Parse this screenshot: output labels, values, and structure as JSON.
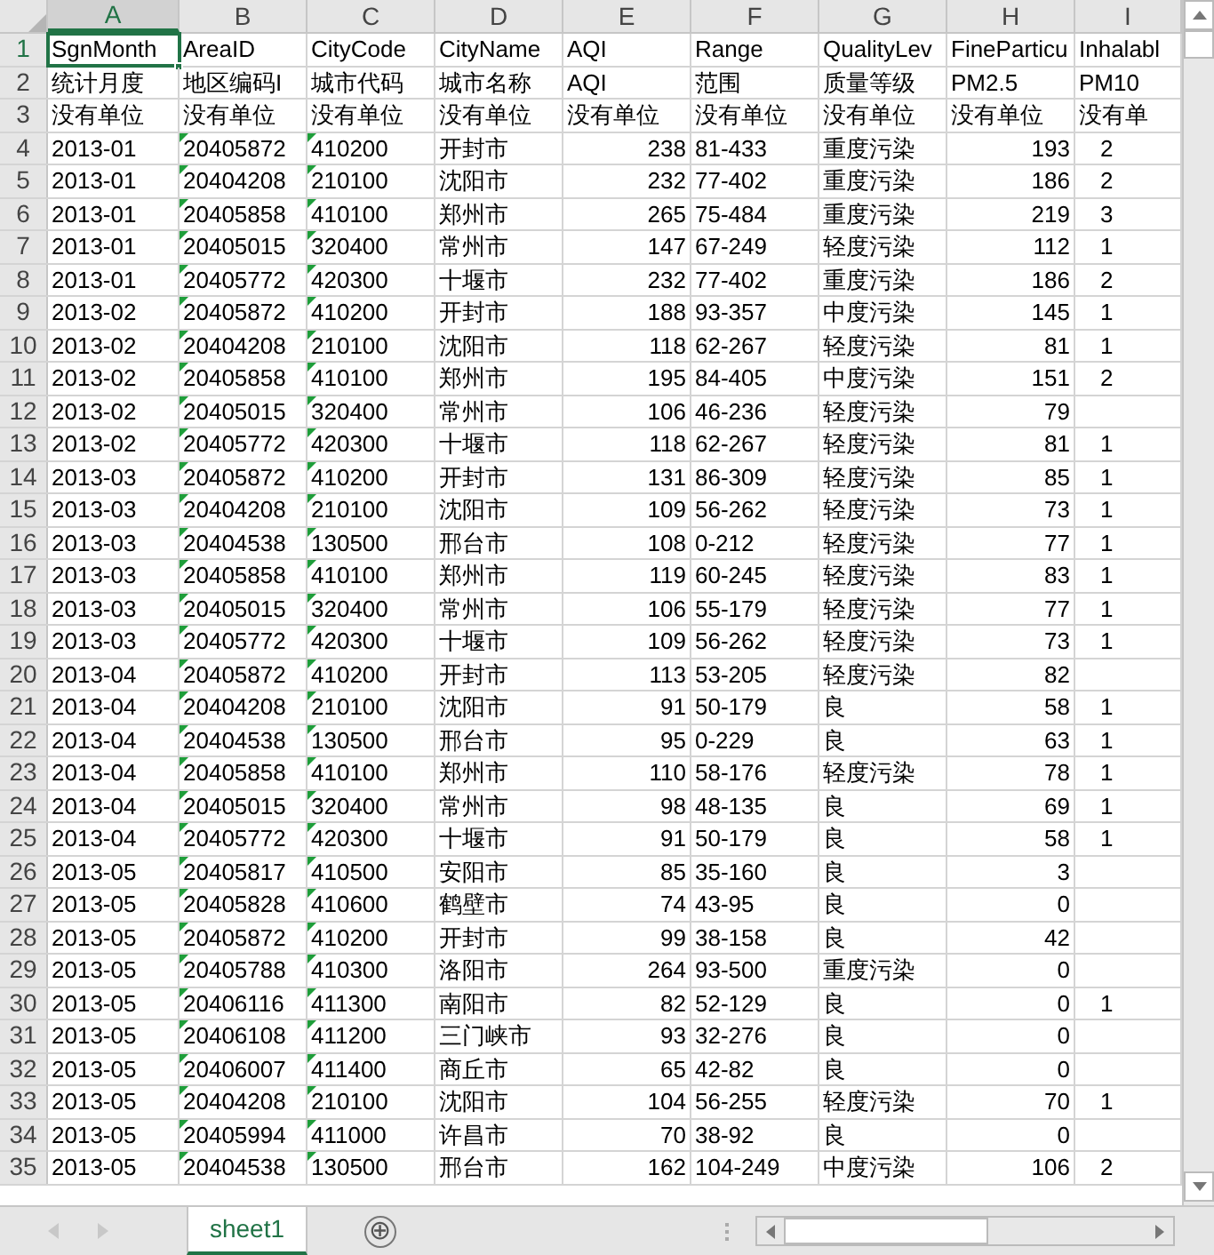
{
  "sheet": {
    "columns": [
      {
        "label": "A",
        "selected": true,
        "kind": "text"
      },
      {
        "label": "B",
        "selected": false,
        "kind": "flagged"
      },
      {
        "label": "C",
        "selected": false,
        "kind": "flagged"
      },
      {
        "label": "D",
        "selected": false,
        "kind": "text"
      },
      {
        "label": "E",
        "selected": false,
        "kind": "number"
      },
      {
        "label": "F",
        "selected": false,
        "kind": "text"
      },
      {
        "label": "G",
        "selected": false,
        "kind": "text"
      },
      {
        "label": "H",
        "selected": false,
        "kind": "number"
      },
      {
        "label": "I",
        "selected": false,
        "kind": "cut"
      }
    ],
    "rows": [
      {
        "number": "1",
        "selected": true,
        "kind": "header",
        "cells": [
          "SgnMonth",
          "AreaID",
          "CityCode",
          "CityName",
          "AQI",
          "Range",
          "QualityLev",
          "FineParticu",
          "Inhalabl"
        ]
      },
      {
        "number": "2",
        "selected": false,
        "kind": "header",
        "cells": [
          "统计月度",
          "地区编码I",
          "城市代码",
          "城市名称",
          "AQI",
          "范围",
          "质量等级",
          "PM2.5",
          "PM10"
        ]
      },
      {
        "number": "3",
        "selected": false,
        "kind": "header",
        "cells": [
          "没有单位",
          "没有单位",
          "没有单位",
          "没有单位",
          "没有单位",
          "没有单位",
          "没有单位",
          "没有单位",
          "没有单"
        ]
      },
      {
        "number": "4",
        "selected": false,
        "kind": "data",
        "cells": [
          "2013-01",
          "20405872",
          "410200",
          "开封市",
          "238",
          "81-433",
          "重度污染",
          "193",
          "2"
        ]
      },
      {
        "number": "5",
        "selected": false,
        "kind": "data",
        "cells": [
          "2013-01",
          "20404208",
          "210100",
          "沈阳市",
          "232",
          "77-402",
          "重度污染",
          "186",
          "2"
        ]
      },
      {
        "number": "6",
        "selected": false,
        "kind": "data",
        "cells": [
          "2013-01",
          "20405858",
          "410100",
          "郑州市",
          "265",
          "75-484",
          "重度污染",
          "219",
          "3"
        ]
      },
      {
        "number": "7",
        "selected": false,
        "kind": "data",
        "cells": [
          "2013-01",
          "20405015",
          "320400",
          "常州市",
          "147",
          "67-249",
          "轻度污染",
          "112",
          "1"
        ]
      },
      {
        "number": "8",
        "selected": false,
        "kind": "data",
        "cells": [
          "2013-01",
          "20405772",
          "420300",
          "十堰市",
          "232",
          "77-402",
          "重度污染",
          "186",
          "2"
        ]
      },
      {
        "number": "9",
        "selected": false,
        "kind": "data",
        "cells": [
          "2013-02",
          "20405872",
          "410200",
          "开封市",
          "188",
          "93-357",
          "中度污染",
          "145",
          "1"
        ]
      },
      {
        "number": "10",
        "selected": false,
        "kind": "data",
        "cells": [
          "2013-02",
          "20404208",
          "210100",
          "沈阳市",
          "118",
          "62-267",
          "轻度污染",
          "81",
          "1"
        ]
      },
      {
        "number": "11",
        "selected": false,
        "kind": "data",
        "cells": [
          "2013-02",
          "20405858",
          "410100",
          "郑州市",
          "195",
          "84-405",
          "中度污染",
          "151",
          "2"
        ]
      },
      {
        "number": "12",
        "selected": false,
        "kind": "data",
        "cells": [
          "2013-02",
          "20405015",
          "320400",
          "常州市",
          "106",
          "46-236",
          "轻度污染",
          "79",
          null
        ]
      },
      {
        "number": "13",
        "selected": false,
        "kind": "data",
        "cells": [
          "2013-02",
          "20405772",
          "420300",
          "十堰市",
          "118",
          "62-267",
          "轻度污染",
          "81",
          "1"
        ]
      },
      {
        "number": "14",
        "selected": false,
        "kind": "data",
        "cells": [
          "2013-03",
          "20405872",
          "410200",
          "开封市",
          "131",
          "86-309",
          "轻度污染",
          "85",
          "1"
        ]
      },
      {
        "number": "15",
        "selected": false,
        "kind": "data",
        "cells": [
          "2013-03",
          "20404208",
          "210100",
          "沈阳市",
          "109",
          "56-262",
          "轻度污染",
          "73",
          "1"
        ]
      },
      {
        "number": "16",
        "selected": false,
        "kind": "data",
        "cells": [
          "2013-03",
          "20404538",
          "130500",
          "邢台市",
          "108",
          "0-212",
          "轻度污染",
          "77",
          "1"
        ]
      },
      {
        "number": "17",
        "selected": false,
        "kind": "data",
        "cells": [
          "2013-03",
          "20405858",
          "410100",
          "郑州市",
          "119",
          "60-245",
          "轻度污染",
          "83",
          "1"
        ]
      },
      {
        "number": "18",
        "selected": false,
        "kind": "data",
        "cells": [
          "2013-03",
          "20405015",
          "320400",
          "常州市",
          "106",
          "55-179",
          "轻度污染",
          "77",
          "1"
        ]
      },
      {
        "number": "19",
        "selected": false,
        "kind": "data",
        "cells": [
          "2013-03",
          "20405772",
          "420300",
          "十堰市",
          "109",
          "56-262",
          "轻度污染",
          "73",
          "1"
        ]
      },
      {
        "number": "20",
        "selected": false,
        "kind": "data",
        "cells": [
          "2013-04",
          "20405872",
          "410200",
          "开封市",
          "113",
          "53-205",
          "轻度污染",
          "82",
          null
        ]
      },
      {
        "number": "21",
        "selected": false,
        "kind": "data",
        "cells": [
          "2013-04",
          "20404208",
          "210100",
          "沈阳市",
          "91",
          "50-179",
          "良",
          "58",
          "1"
        ]
      },
      {
        "number": "22",
        "selected": false,
        "kind": "data",
        "cells": [
          "2013-04",
          "20404538",
          "130500",
          "邢台市",
          "95",
          "0-229",
          "良",
          "63",
          "1"
        ]
      },
      {
        "number": "23",
        "selected": false,
        "kind": "data",
        "cells": [
          "2013-04",
          "20405858",
          "410100",
          "郑州市",
          "110",
          "58-176",
          "轻度污染",
          "78",
          "1"
        ]
      },
      {
        "number": "24",
        "selected": false,
        "kind": "data",
        "cells": [
          "2013-04",
          "20405015",
          "320400",
          "常州市",
          "98",
          "48-135",
          "良",
          "69",
          "1"
        ]
      },
      {
        "number": "25",
        "selected": false,
        "kind": "data",
        "cells": [
          "2013-04",
          "20405772",
          "420300",
          "十堰市",
          "91",
          "50-179",
          "良",
          "58",
          "1"
        ]
      },
      {
        "number": "26",
        "selected": false,
        "kind": "data",
        "cells": [
          "2013-05",
          "20405817",
          "410500",
          "安阳市",
          "85",
          "35-160",
          "良",
          "3",
          null
        ]
      },
      {
        "number": "27",
        "selected": false,
        "kind": "data",
        "cells": [
          "2013-05",
          "20405828",
          "410600",
          "鹤壁市",
          "74",
          "43-95",
          "良",
          "0",
          null
        ]
      },
      {
        "number": "28",
        "selected": false,
        "kind": "data",
        "cells": [
          "2013-05",
          "20405872",
          "410200",
          "开封市",
          "99",
          "38-158",
          "良",
          "42",
          null
        ]
      },
      {
        "number": "29",
        "selected": false,
        "kind": "data",
        "cells": [
          "2013-05",
          "20405788",
          "410300",
          "洛阳市",
          "264",
          "93-500",
          "重度污染",
          "0",
          null
        ]
      },
      {
        "number": "30",
        "selected": false,
        "kind": "data",
        "cells": [
          "2013-05",
          "20406116",
          "411300",
          "南阳市",
          "82",
          "52-129",
          "良",
          "0",
          "1"
        ]
      },
      {
        "number": "31",
        "selected": false,
        "kind": "data",
        "cells": [
          "2013-05",
          "20406108",
          "411200",
          "三门峡市",
          "93",
          "32-276",
          "良",
          "0",
          null
        ]
      },
      {
        "number": "32",
        "selected": false,
        "kind": "data",
        "cells": [
          "2013-05",
          "20406007",
          "411400",
          "商丘市",
          "65",
          "42-82",
          "良",
          "0",
          null
        ]
      },
      {
        "number": "33",
        "selected": false,
        "kind": "data",
        "cells": [
          "2013-05",
          "20404208",
          "210100",
          "沈阳市",
          "104",
          "56-255",
          "轻度污染",
          "70",
          "1"
        ]
      },
      {
        "number": "34",
        "selected": false,
        "kind": "data",
        "cells": [
          "2013-05",
          "20405994",
          "411000",
          "许昌市",
          "70",
          "38-92",
          "良",
          "0",
          null
        ]
      },
      {
        "number": "35",
        "selected": false,
        "kind": "data",
        "cells": [
          "2013-05",
          "20404538",
          "130500",
          "邢台市",
          "162",
          "104-249",
          "中度污染",
          "106",
          "2"
        ]
      }
    ]
  },
  "sheet_tabs": [
    {
      "label": "sheet1",
      "selected": true
    }
  ],
  "add_sheet": "⊕"
}
